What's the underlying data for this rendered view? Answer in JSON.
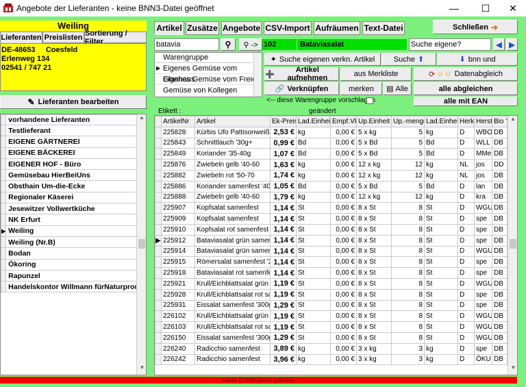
{
  "window": {
    "title": "Angebote der Lieferanten   -  keine BNN3-Datei geöffnet"
  },
  "left": {
    "supplier_name": "Weiling",
    "tabs": [
      "Lieferanten",
      "Preislisten",
      "Sortierung / Filter"
    ],
    "address": [
      "DE-48653     Coesfeld",
      "Erlenweg 134",
      "02541 / 747 21"
    ],
    "edit_button": "Lieferanten bearbeiten",
    "list_header": "vorhandene Lieferanten",
    "suppliers": [
      "Testlieferant",
      "EIGENE GÄRTNEREI",
      "EIGENE BÄCKEREI",
      "EIGENER HOF - Büro",
      "Gemüsebau HierBeiUns",
      "Obsthain Um-die-Ecke",
      "Regionaler Käserei",
      "Jesewitzer Vollwertküche",
      "NK Erfurt",
      "Weiling",
      "Weiling (Nr.B)",
      "Bodan",
      "Ökoring",
      "Rapunzel",
      "Handelskontor Willmann fürNaturproduk"
    ],
    "selected_supplier": "Weiling"
  },
  "top_tabs": [
    "Artikel",
    "Zusätze",
    "Angebote",
    "CSV-Import",
    "Aufräumen",
    "Text-Datei"
  ],
  "close_button": "Schließen",
  "search": {
    "value": "batavia",
    "result_id": "102",
    "result_name": "Bataviasalat",
    "suche_eigene_placeholder": "Suche eigene?"
  },
  "warengruppe": {
    "header": "Warengruppe",
    "items": [
      "Eigenes Gemüse vom Glashaus",
      "Eigenes Gemüse vom Freien",
      "Gemüse von Kollegen"
    ]
  },
  "actions": {
    "suche_eigenen": "Suche eigenen verkn. Artikel",
    "suche": "Suche",
    "bnn_und": "bnn und",
    "artikel_aufnehmen": "Artikel aufnehmen",
    "aus_merkliste": "aus Merkliste",
    "datenabgleich": "Datenabgleich",
    "verknuepfen": "Verknüpfen",
    "merken": "merken",
    "alle": "Alle",
    "alle_abgleichen": "alle abgleichen",
    "warengruppe_vorschlagen": "<-- diese Warengruppe vorschlagen",
    "alle_mit_ean": "alle mit EAN"
  },
  "labels": {
    "etikett": "Etikett :",
    "geaendert": "geändert"
  },
  "table": {
    "columns": [
      "ArtikelNr",
      "Artikel",
      "Ek-Preis",
      "Lad.Einheit",
      "Empf.Vk",
      "Up.Einheit",
      "Up.-menge",
      "Lad.Einheit",
      "Herk",
      "Herst",
      "Bio ?"
    ],
    "rows": [
      [
        "225828",
        "Kürbis Ufo Pattisonweiß sa",
        "2,53 €",
        "kg",
        "0,00 €",
        "5 x kg",
        "5",
        "kg",
        "D",
        "WBO",
        "DB"
      ],
      [
        "225843",
        "Schnittlauch  '30g+",
        "0,99 €",
        "Bd",
        "0,00 €",
        "5 x Bd",
        "5",
        "Bd",
        "D",
        "WLL",
        "DB"
      ],
      [
        "225849",
        "Koriander  '35-40g",
        "1,07 €",
        "Bd",
        "0,00 €",
        "5 x Bd",
        "5",
        "Bd",
        "D",
        "MMei",
        "DB"
      ],
      [
        "225876",
        "Zwiebeln gelb  '40-60",
        "1,63 €",
        "kg",
        "0,00 €",
        "12 x kg",
        "12",
        "kg",
        "NL",
        "jos",
        "DD"
      ],
      [
        "225882",
        "Zwiebeln rot  '50-70",
        "1,74 €",
        "kg",
        "0,00 €",
        "12 x kg",
        "12",
        "kg",
        "NL",
        "jos",
        "DB"
      ],
      [
        "225886",
        "Koriander samenfest  '40g",
        "1,05 €",
        "Bd",
        "0,00 €",
        "5 x Bd",
        "5",
        "Bd",
        "D",
        "lan",
        "DB"
      ],
      [
        "225888",
        "Zwiebeln gelb  '40-60",
        "1,79 €",
        "kg",
        "0,00 €",
        "12 x kg",
        "12",
        "kg",
        "D",
        "kra",
        "DB"
      ],
      [
        "225907",
        "Kopfsalat samenfest",
        "1,14 €",
        "St",
        "0,00 €",
        "8 x St",
        "8",
        "St",
        "D",
        "WGU",
        "DB"
      ],
      [
        "225909",
        "Kopfsalat samenfest",
        "1,14 €",
        "St",
        "0,00 €",
        "8 x St",
        "8",
        "St",
        "D",
        "spe",
        "DB"
      ],
      [
        "225910",
        "Kopfsalat rot samenfest",
        "1,14 €",
        "St",
        "0,00 €",
        "8 x St",
        "8",
        "St",
        "D",
        "spe",
        "DB"
      ],
      [
        "225912",
        "Bataviasalat grün samenfe",
        "1,14 €",
        "St",
        "0,00 €",
        "8 x St",
        "8",
        "St",
        "D",
        "spe",
        "DB"
      ],
      [
        "225914",
        "Bataviasalat grün samenfe",
        "1,14 €",
        "St",
        "0,00 €",
        "8 x St",
        "8",
        "St",
        "D",
        "WGU",
        "DB"
      ],
      [
        "225915",
        "Römersalat samenfest  '25",
        "1,14 €",
        "St",
        "0,00 €",
        "8 x St",
        "8",
        "St",
        "D",
        "spe",
        "DB"
      ],
      [
        "225918",
        "Bataviasalat rot samenfest",
        "1,14 €",
        "St",
        "0,00 €",
        "8 x St",
        "8",
        "St",
        "D",
        "spe",
        "DB"
      ],
      [
        "225921",
        "Krull/Eichblattsalat grün sa",
        "1,19 €",
        "St",
        "0,00 €",
        "8 x St",
        "8",
        "St",
        "D",
        "WGU",
        "DB"
      ],
      [
        "225928",
        "Krull/Eichblattsalat rot sam",
        "1,19 €",
        "St",
        "0,00 €",
        "8 x St",
        "8",
        "St",
        "D",
        "spe",
        "DB"
      ],
      [
        "225931",
        "Eissalat samenfest  '300g+",
        "1,29 €",
        "St",
        "0,00 €",
        "8 x St",
        "8",
        "St",
        "D",
        "spe",
        "DB"
      ],
      [
        "226102",
        "Krull/Eichblattsalat grün sa",
        "1,19 €",
        "St",
        "0,00 €",
        "8 x St",
        "8",
        "St",
        "D",
        "WGU",
        "DB"
      ],
      [
        "226103",
        "Krull/Eichblattsalat rot sam",
        "1,19 €",
        "St",
        "0,00 €",
        "8 x St",
        "8",
        "St",
        "D",
        "WGU",
        "DB"
      ],
      [
        "226150",
        "Eissalat samenfest  '300g+",
        "1,29 €",
        "St",
        "0,00 €",
        "8 x St",
        "8",
        "St",
        "D",
        "WGU",
        "DB"
      ],
      [
        "226240",
        "Radicchio samenfest",
        "3,89 €",
        "kg",
        "0,00 €",
        "3 x kg",
        "3",
        "kg",
        "D",
        "spe",
        "DB"
      ],
      [
        "226242",
        "Radicchio samenfest",
        "3,96 €",
        "kg",
        "0,00 €",
        "3 x kg",
        "3",
        "kg",
        "D",
        "ÖKU",
        "DB"
      ]
    ],
    "selected_row": 10
  },
  "status_bar": "keine BNN3-Datei geladen"
}
